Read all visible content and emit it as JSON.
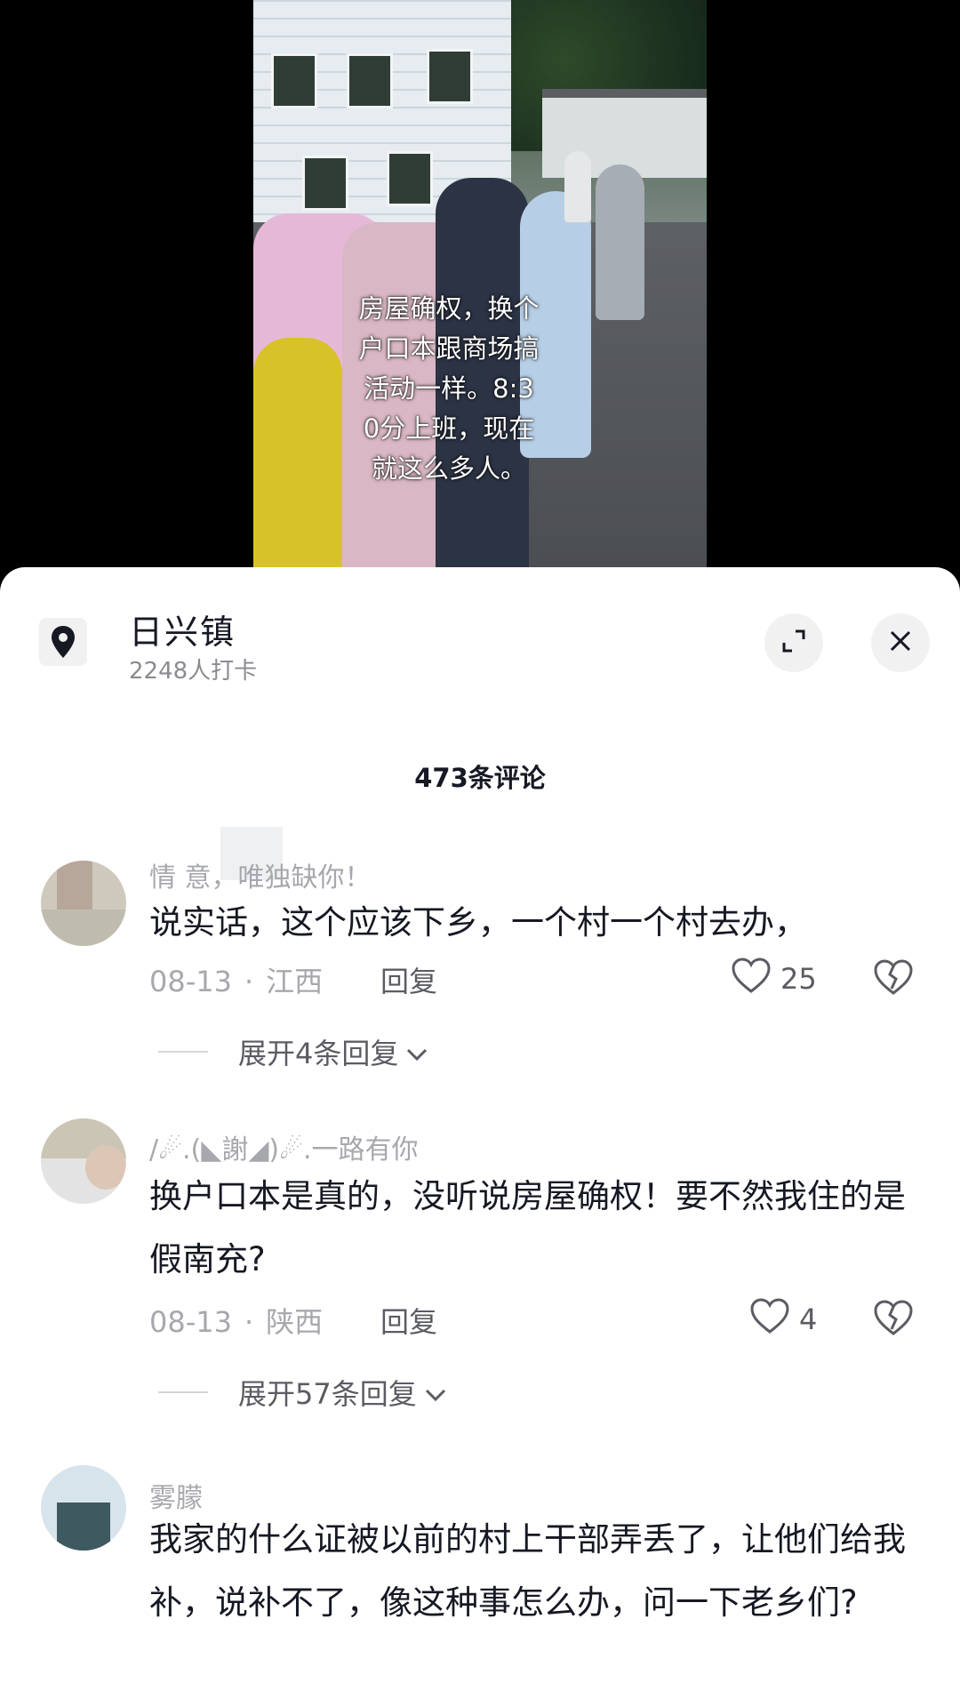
{
  "video": {
    "caption": "房屋确权，换个户口本跟商场搞活动一样。8:30分上班，现在就这么多人。"
  },
  "location": {
    "icon": "location-pin-icon",
    "name": "日兴镇",
    "checkins": "2248人打卡"
  },
  "header_actions": {
    "expand_icon": "expand-icon",
    "close_icon": "close-icon"
  },
  "comments_count_title": "473条评论",
  "comments": [
    {
      "user": "情  意，唯独缺你！",
      "text": "说实话，这个应该下乡，一个村一个村去办，",
      "date": "08-13",
      "region": "江西",
      "reply_label": "回复",
      "likes": "25",
      "expand_label": "展开4条回复"
    },
    {
      "user": "/☄.(◣謝◢)☄.一路有你",
      "text": "换户口本是真的，没听说房屋确权！要不然我住的是假南充?",
      "date": "08-13",
      "region": "陕西",
      "reply_label": "回复",
      "likes": "4",
      "expand_label": "展开57条回复"
    },
    {
      "user": "雾朦",
      "text": "我家的什么证被以前的村上干部弄丢了，让他们给我补，说补不了，像这种事怎么办，问一下老乡们?"
    }
  ],
  "colors": {
    "sheet_bg": "#ffffff",
    "primary_text": "#161823",
    "secondary_text": "#a7a8ad",
    "button_bg": "#f1f1f2"
  }
}
